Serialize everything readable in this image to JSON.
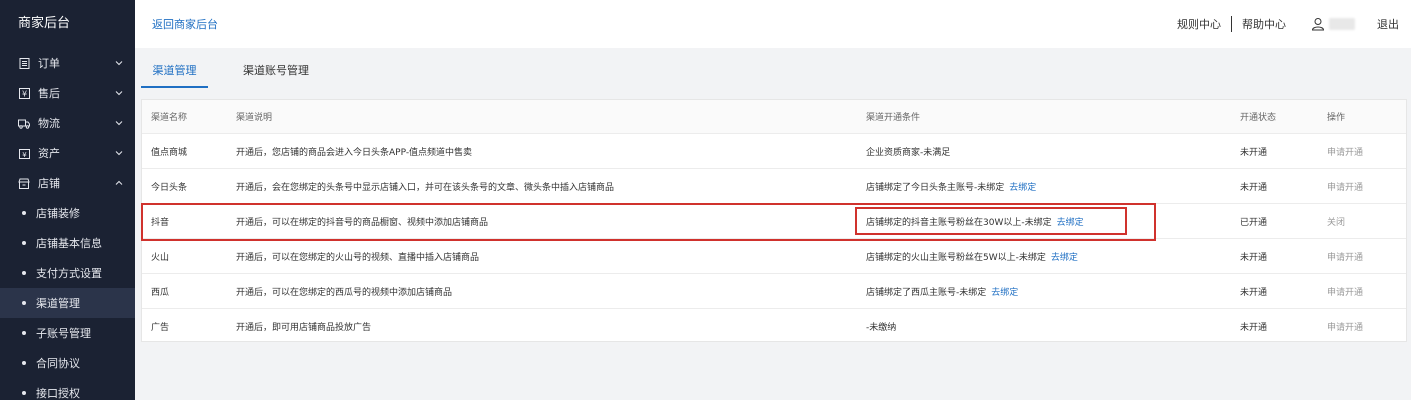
{
  "sidebar": {
    "brand": "商家后台",
    "menus": [
      {
        "label": "订单",
        "icon": "order-icon"
      },
      {
        "label": "售后",
        "icon": "after-sale-icon"
      },
      {
        "label": "物流",
        "icon": "logistics-icon"
      },
      {
        "label": "资产",
        "icon": "asset-icon"
      },
      {
        "label": "店铺",
        "icon": "store-icon"
      }
    ],
    "sub_items": [
      {
        "label": "店铺装修"
      },
      {
        "label": "店铺基本信息"
      },
      {
        "label": "支付方式设置"
      },
      {
        "label": "渠道管理",
        "active": true
      },
      {
        "label": "子账号管理"
      },
      {
        "label": "合同协议"
      },
      {
        "label": "接口授权"
      }
    ]
  },
  "header": {
    "back_link": "返回商家后台",
    "rules": "规则中心",
    "help": "帮助中心",
    "logout": "退出"
  },
  "tabs": [
    {
      "label": "渠道管理",
      "active": true
    },
    {
      "label": "渠道账号管理",
      "active": false
    }
  ],
  "table": {
    "columns": [
      "渠道名称",
      "渠道说明",
      "渠道开通条件",
      "开通状态",
      "操作"
    ],
    "rows": [
      {
        "name": "值点商城",
        "desc": "开通后，您店铺的商品会进入今日头条APP-值点频道中售卖",
        "condition": "企业资质商家-未满足",
        "bind_link": "",
        "status": "未开通",
        "action": "申请开通"
      },
      {
        "name": "今日头条",
        "desc": "开通后，会在您绑定的头条号中显示店铺入口，并可在该头条号的文章、微头条中插入店铺商品",
        "condition": "店铺绑定了今日头条主账号-未绑定",
        "bind_link": "去绑定",
        "status": "未开通",
        "action": "申请开通"
      },
      {
        "name": "抖音",
        "desc": "开通后，可以在绑定的抖音号的商品橱窗、视频中添加店铺商品",
        "condition": "店铺绑定的抖音主账号粉丝在30W以上-未绑定",
        "bind_link": "去绑定",
        "status": "已开通",
        "action": "关闭"
      },
      {
        "name": "火山",
        "desc": "开通后，可以在您绑定的火山号的视频、直播中插入店铺商品",
        "condition": "店铺绑定的火山主账号粉丝在5W以上-未绑定",
        "bind_link": "去绑定",
        "status": "未开通",
        "action": "申请开通"
      },
      {
        "name": "西瓜",
        "desc": "开通后，可以在您绑定的西瓜号的视频中添加店铺商品",
        "condition": "店铺绑定了西瓜主账号-未绑定",
        "bind_link": "去绑定",
        "status": "未开通",
        "action": "申请开通"
      },
      {
        "name": "广告",
        "desc": "开通后，即可用店铺商品投放广告",
        "condition": "-未缴纳",
        "bind_link": "",
        "status": "未开通",
        "action": "申请开通"
      }
    ]
  },
  "colors": {
    "sidebar_bg": "#1b2233",
    "accent": "#1f6fc3",
    "highlight_border": "#d0322d"
  }
}
